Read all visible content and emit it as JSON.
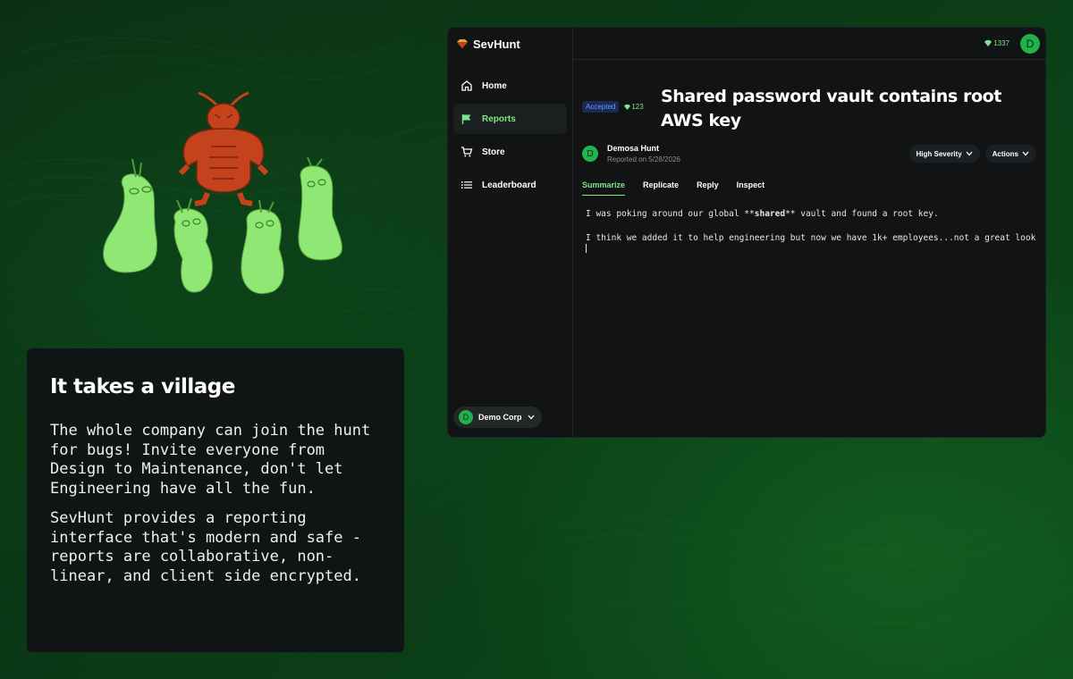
{
  "info": {
    "title": "It takes a village",
    "paragraph1": "The whole company can join the hunt for bugs! Invite everyone from Design to Maintenance, don't let Engineering have all the fun.",
    "paragraph2": "SevHunt provides a reporting interface that's modern and safe - reports are collaborative, non-linear, and client side encrypted."
  },
  "app": {
    "brand": "SevHunt",
    "nav": [
      {
        "label": "Home",
        "icon": "home-icon"
      },
      {
        "label": "Reports",
        "icon": "flag-icon",
        "active": true
      },
      {
        "label": "Store",
        "icon": "cart-icon"
      },
      {
        "label": "Leaderboard",
        "icon": "list-icon"
      }
    ],
    "org": {
      "initial": "D",
      "name": "Demo Corp"
    },
    "topbar": {
      "points": "1337",
      "avatar_initial": "D"
    },
    "report": {
      "status": "Accepted",
      "points": "123",
      "title": "Shared password vault contains root AWS key",
      "reporter_initial": "D",
      "reporter_name": "Demosa Hunt",
      "reported_on": "Reported on 5/28/2026",
      "severity_label": "High Severity",
      "actions_label": "Actions",
      "tabs": [
        "Summarize",
        "Replicate",
        "Reply",
        "Inspect"
      ],
      "body_line1_pre": "I was poking around our global **",
      "body_line1_bold": "shared",
      "body_line1_post": "** vault and found a root key.",
      "body_line2": "I think we added it to help engineering but now we have 1k+ employees...not a great look"
    }
  },
  "colors": {
    "accent": "#7ee787",
    "avatar": "#22b14c",
    "badge": "#6b9cff",
    "bug": "#c4431c",
    "villager": "#8fe874"
  }
}
